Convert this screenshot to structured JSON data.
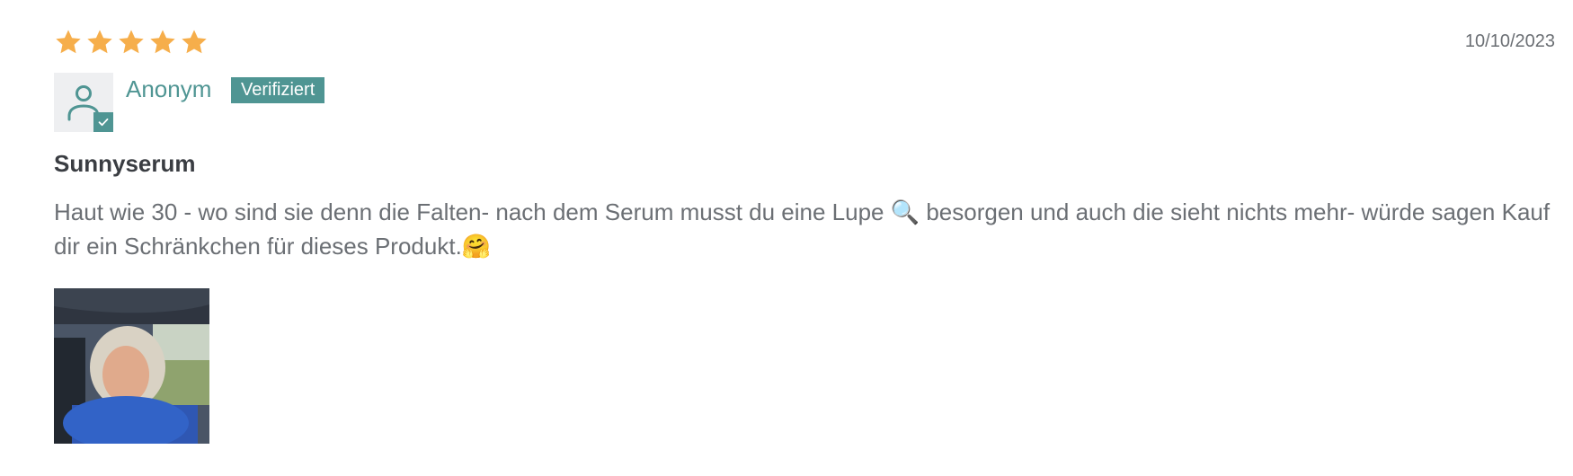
{
  "review": {
    "rating": 5,
    "rating_max": 5,
    "date": "10/10/2023",
    "author": {
      "name": "Anonym",
      "badge": "Verifiziert"
    },
    "title": "Sunnyserum",
    "body": "Haut wie 30 - wo sind sie denn die Falten- nach dem Serum musst du eine Lupe 🔍 besorgen und auch die sieht nichts mehr- würde sagen Kauf dir ein Schränkchen für dieses Produkt.🤗",
    "photo_icon": "review-photo"
  },
  "colors": {
    "star": "#f6ae4b",
    "accent": "#4f9593",
    "text": "#6b6f74",
    "title": "#3a3d42"
  }
}
